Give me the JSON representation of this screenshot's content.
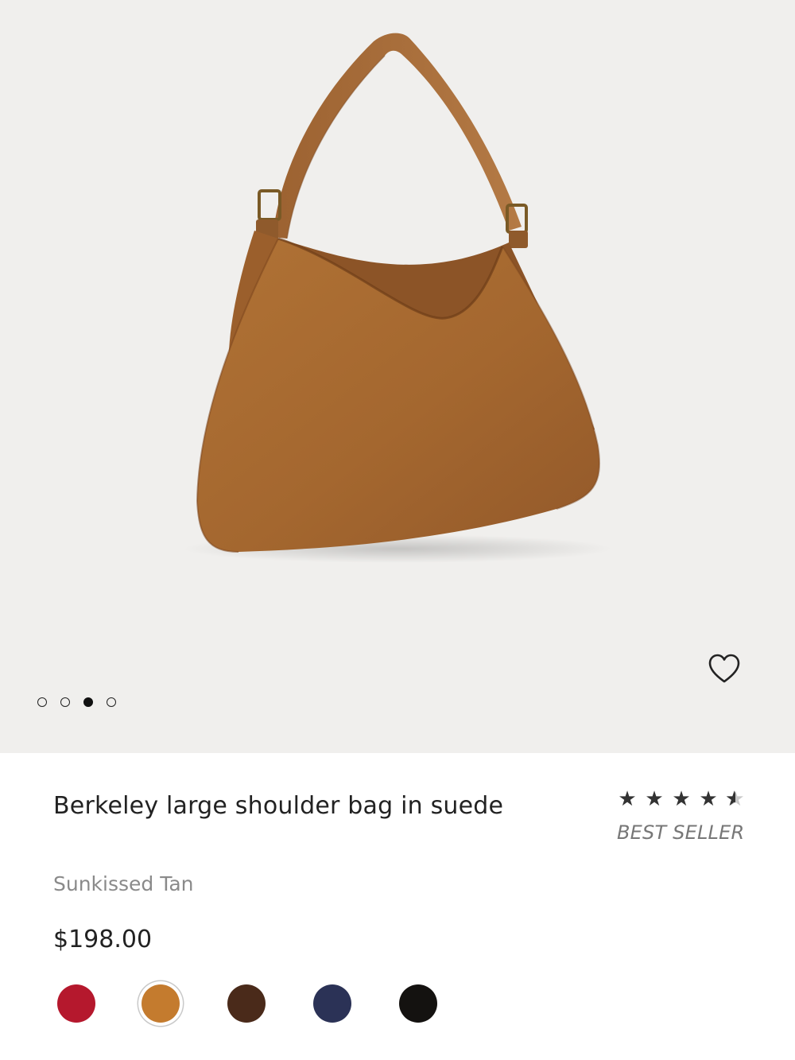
{
  "product": {
    "title": "Berkeley large shoulder bag in suede",
    "color_name": "Sunkissed Tan",
    "price": "$198.00",
    "rating": 4.5,
    "rating_max": 5,
    "badge": "BEST SELLER"
  },
  "gallery": {
    "image_count": 4,
    "active_index": 2,
    "image_icon": "suede-shoulder-bag"
  },
  "icons": {
    "wishlist": "heart-outline-icon",
    "star": "star-icon"
  },
  "swatches": [
    {
      "color": "#b5182d",
      "selected": false
    },
    {
      "color": "#c47b2e",
      "selected": true
    },
    {
      "color": "#4a2a1a",
      "selected": false
    },
    {
      "color": "#2b3256",
      "selected": false
    },
    {
      "color": "#141210",
      "selected": false
    }
  ],
  "colors": {
    "hero_background": "#f0efed",
    "bag_tan": "#a8682f",
    "text_primary": "#222222",
    "text_muted": "#8a8a8a"
  }
}
